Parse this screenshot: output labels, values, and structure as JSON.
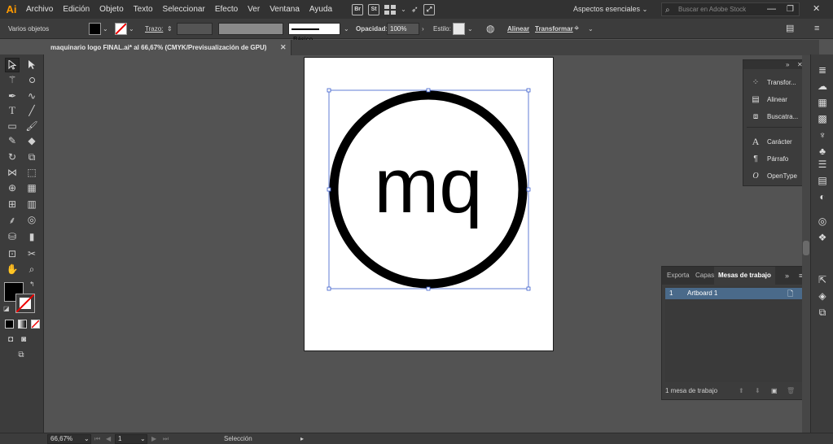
{
  "menubar": {
    "app_icon": "Ai",
    "items": [
      "Archivo",
      "Edición",
      "Objeto",
      "Texto",
      "Seleccionar",
      "Efecto",
      "Ver",
      "Ventana",
      "Ayuda"
    ],
    "bridge_icon": "Br",
    "stock_icon": "St",
    "workspace": "Aspectos esenciales",
    "search_placeholder": "Buscar en Adobe Stock"
  },
  "controlbar": {
    "selection_label": "Varios objetos",
    "stroke_label": "Trazo:",
    "brush_style": "Básico",
    "opacity_label": "Opacidad:",
    "opacity_value": "100%",
    "style_label": "Estilo:",
    "align_label": "Alinear",
    "transform_label": "Transformar"
  },
  "document": {
    "tab_title": "maquinario logo FINAL.ai* al 66,67% (CMYK/Previsualización de GPU)",
    "close_glyph": "✕"
  },
  "artwork": {
    "logo_text": "mq"
  },
  "icon_panel": {
    "items": [
      {
        "label": "Transfor...",
        "icon": "transform-icon"
      },
      {
        "label": "Alinear",
        "icon": "align-icon"
      },
      {
        "label": "Buscatra...",
        "icon": "pathfinder-icon"
      },
      {
        "label": "Carácter",
        "icon": "character-icon"
      },
      {
        "label": "Párrafo",
        "icon": "paragraph-icon"
      },
      {
        "label": "OpenType",
        "icon": "opentype-icon"
      }
    ]
  },
  "artboards_panel": {
    "tabs": [
      "Exporta",
      "Capas",
      "Mesas de trabajo"
    ],
    "rows": [
      {
        "index": "1",
        "name": "Artboard 1"
      }
    ],
    "footer": "1 mesa de trabajo"
  },
  "statusbar": {
    "zoom": "66,67%",
    "artboard_number": "1",
    "tool_status": "Selección"
  },
  "colors": {
    "accent_selection": "#4a6a8a",
    "bounding_box": "#3a5ccc",
    "app_icon": "#ff9a00"
  }
}
